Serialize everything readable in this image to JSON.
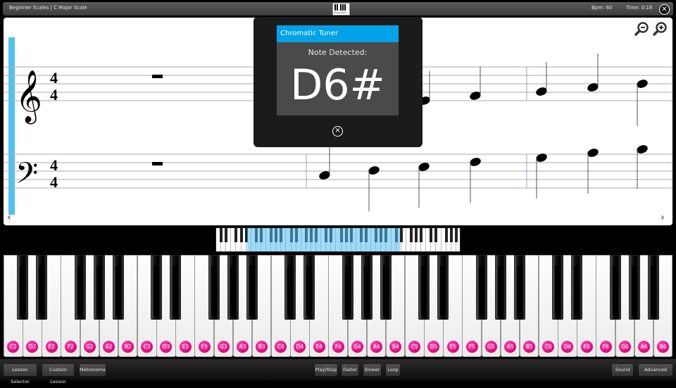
{
  "header": {
    "breadcrumb": "Beginner Scales  |  C Major Scale",
    "logo_text": "Purely Piano",
    "bpm": "Bpm: 60",
    "time": "Time: 0:16",
    "close_icon": "close-circle-icon"
  },
  "score": {
    "time_signature_top": "4",
    "time_signature_bottom": "4",
    "treble_clef_glyph": "𝄞",
    "bass_clef_glyph": "𝄢",
    "zoom_out_icon": "zoom-out-icon",
    "zoom_in_icon": "zoom-in-icon",
    "prev_arrow": "‹",
    "next_arrow": "›",
    "accent_color": "#4ec2f0"
  },
  "tuner": {
    "title": "Chromatic Tuner",
    "label": "Note Detected:",
    "note": "D6#",
    "close_glyph": "⊗",
    "title_color": "#00a2e8"
  },
  "keyboard": {
    "white_keys": [
      "C2",
      "D2",
      "E2",
      "F2",
      "G2",
      "A2",
      "B2",
      "C3",
      "D3",
      "E3",
      "F3",
      "G3",
      "A3",
      "B3",
      "C4",
      "D4",
      "E4",
      "F4",
      "G4",
      "A4",
      "B4",
      "C5",
      "D5",
      "E5",
      "F5",
      "G5",
      "A5",
      "B5",
      "C6",
      "D6",
      "E6",
      "F6",
      "G6",
      "A6",
      "B6"
    ],
    "label_color": "#e6007e"
  },
  "toolbar": {
    "lesson_selector": "Lesson Selector",
    "custom_lesson": "Custom Lesson",
    "metronome": "Metronome",
    "play_stop": "Play/Stop",
    "faster": "Faster",
    "slower": "Slower",
    "loop": "Loop",
    "sound": "Sound",
    "advanced": "Advanced"
  }
}
